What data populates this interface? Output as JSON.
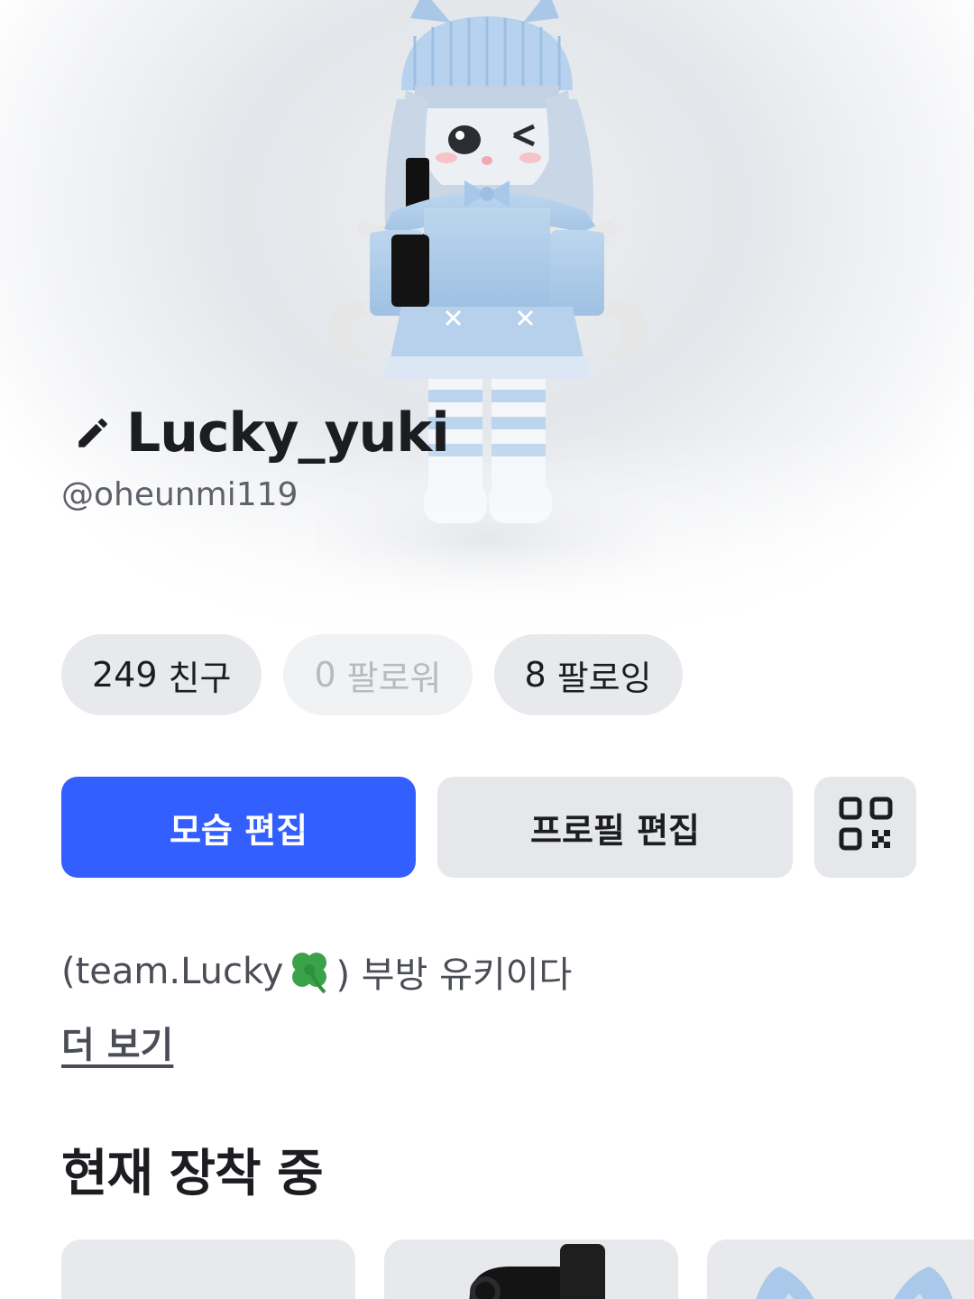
{
  "profile": {
    "display_name": "Lucky_yuki",
    "username": "@oheunmi119",
    "edit_name_icon": "pencil-icon"
  },
  "stats": [
    {
      "count": "249",
      "label": "친구",
      "enabled": true
    },
    {
      "count": "0",
      "label": "팔로워",
      "enabled": false
    },
    {
      "count": "8",
      "label": "팔로잉",
      "enabled": true
    }
  ],
  "actions": {
    "edit_avatar_label": "모습 편집",
    "edit_profile_label": "프로필 편집",
    "qr_icon": "qr-code-icon"
  },
  "bio": {
    "prefix": "(team.Lucky",
    "emoji_icon": "four-leaf-clover-icon",
    "suffix": ") 부방 유키이다",
    "more_label": "더 보기"
  },
  "wearing": {
    "title": "현재 장착 중",
    "items": [
      {
        "icon": "empty-item"
      },
      {
        "icon": "black-backpack-icon"
      },
      {
        "icon": "blue-cat-ears-icon"
      }
    ]
  },
  "colors": {
    "primary_button": "#335fff",
    "pill_bg": "#e8e9ec",
    "text": "#1c1d21"
  }
}
